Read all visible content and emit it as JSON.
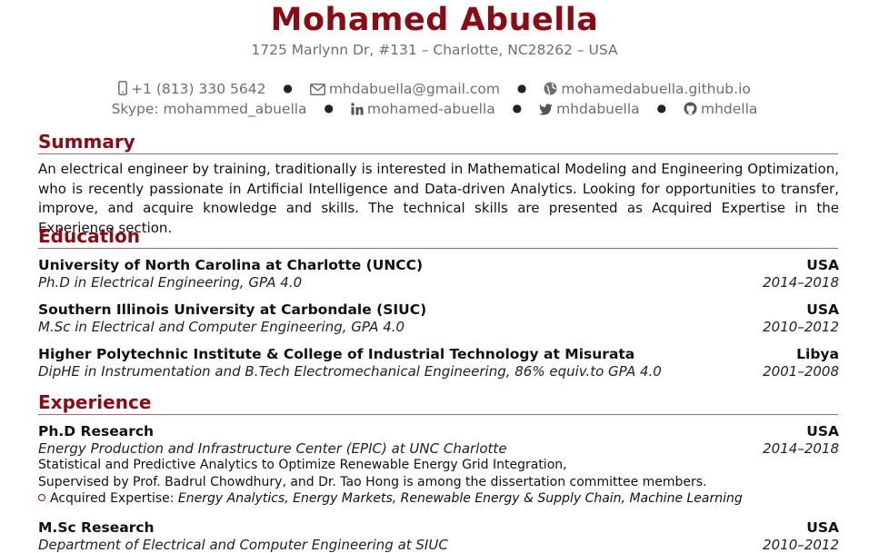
{
  "header": {
    "name": "Mohamed Abuella",
    "address": "1725 Marlynn Dr, #131 – Charlotte, NC28262 – USA",
    "phone": "+1 (813) 330 5642",
    "email": "mhdabuella@gmail.com",
    "website": "mohamedabuella.github.io",
    "skype": "Skype: mohammed_abuella",
    "linkedin": "mohamed-abuella",
    "twitter": "mhdabuella",
    "github": "mhdella"
  },
  "summary": {
    "title": "Summary",
    "text": "An electrical engineer by training, traditionally is interested in Mathematical Modeling and Engineering Optimization, who is recently passionate in Artificial Intelligence and Data-driven Analytics. Looking for opportunities to transfer, improve, and acquire knowledge and skills. The technical skills are presented as Acquired Expertise in the Experience section."
  },
  "education": {
    "title": "Education",
    "items": [
      {
        "school": "University of North Carolina at Charlotte (UNCC)",
        "location": "USA",
        "degree": "Ph.D in Electrical Engineering, GPA 4.0",
        "dates": "2014–2018"
      },
      {
        "school": "Southern Illinois University at Carbondale (SIUC)",
        "location": "USA",
        "degree": "M.Sc in Electrical and Computer Engineering, GPA 4.0",
        "dates": "2010–2012"
      },
      {
        "school": "Higher Polytechnic Institute & College of Industrial Technology at Misurata",
        "location": "Libya",
        "degree": "DipHE in Instrumentation and B.Tech Electromechanical Engineering, 86% equiv.to GPA 4.0",
        "dates": "2001–2008"
      }
    ]
  },
  "experience": {
    "title": "Experience",
    "items": [
      {
        "role": "Ph.D Research",
        "location": "USA",
        "org": "Energy Production and Infrastructure Center (EPIC) at UNC Charlotte",
        "dates": "2014–2018",
        "line1": "Statistical and Predictive Analytics to Optimize Renewable Energy Grid Integration,",
        "line2": "Supervised by Prof. Badrul Chowdhury, and Dr. Tao Hong is among the dissertation committee members.",
        "expertise_label": "Acquired Expertise:",
        "expertise_value": "Energy Analytics, Energy Markets, Renewable Energy & Supply Chain, Machine Learning"
      },
      {
        "role": "M.Sc Research",
        "location": "USA",
        "org": "Department of Electrical and Computer Engineering at SIUC",
        "dates": "2010–2012"
      }
    ]
  },
  "colors": {
    "accent": "#8b0a14",
    "muted": "#6e6e6e"
  }
}
